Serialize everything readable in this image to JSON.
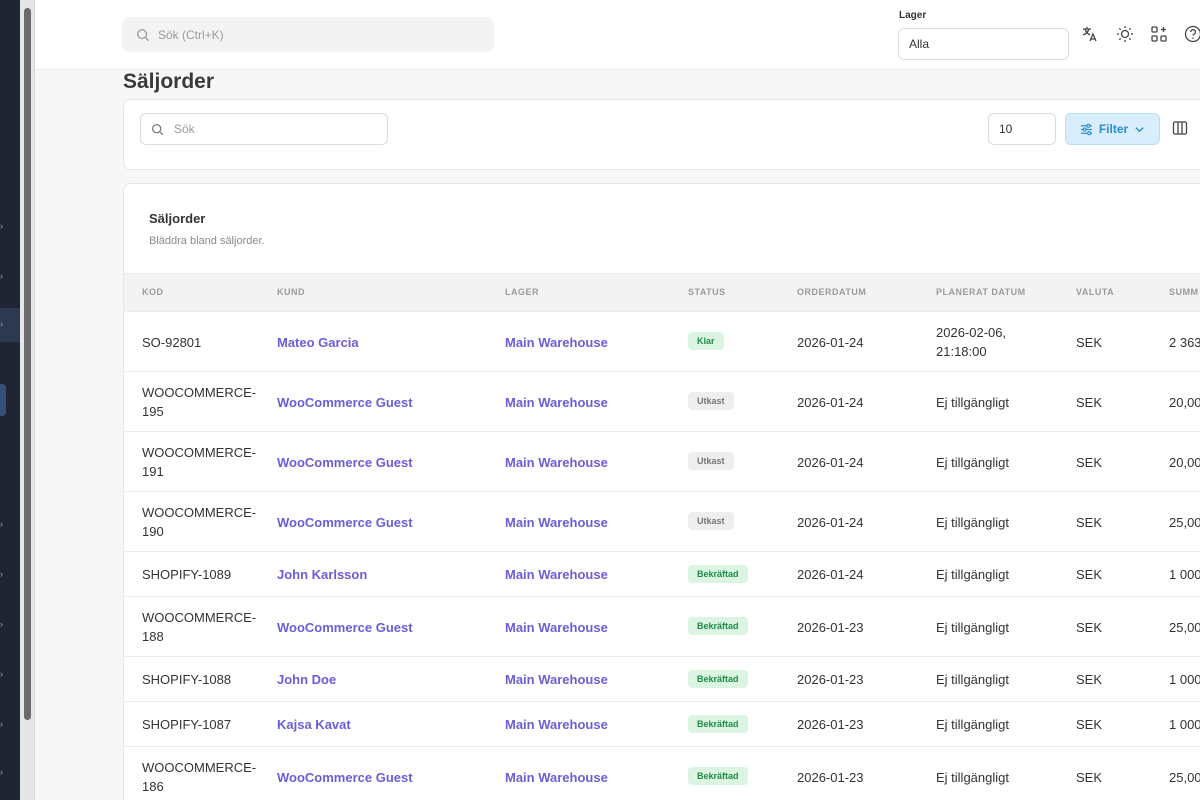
{
  "header": {
    "search_placeholder": "Sök (Ctrl+K)",
    "lager_label": "Lager",
    "lager_value": "Alla"
  },
  "page": {
    "title": "Säljorder"
  },
  "toolbar": {
    "search_placeholder": "Sök",
    "page_size": "10",
    "filter_label": "Filter"
  },
  "card": {
    "title": "Säljorder",
    "subtitle": "Bläddra bland säljorder."
  },
  "columns": [
    "KOD",
    "KUND",
    "LAGER",
    "STATUS",
    "ORDERDATUM",
    "PLANERAT DATUM",
    "VALUTA",
    "SUMM"
  ],
  "rows": [
    {
      "kod": [
        "SO-92801"
      ],
      "kund": "Mateo Garcia",
      "lager": "Main Warehouse",
      "status": "Klar",
      "status_type": "klar",
      "orderdatum": "2026-01-24",
      "planerat": [
        "2026-02-06,",
        "21:18:00"
      ],
      "valuta": "SEK",
      "summa": "2 363"
    },
    {
      "kod": [
        "WOOCOMMERCE-",
        "195"
      ],
      "kund": "WooCommerce Guest",
      "lager": "Main Warehouse",
      "status": "Utkast",
      "status_type": "utkast",
      "orderdatum": "2026-01-24",
      "planerat": [
        "Ej tillgängligt"
      ],
      "valuta": "SEK",
      "summa": "20,00"
    },
    {
      "kod": [
        "WOOCOMMERCE-",
        "191"
      ],
      "kund": "WooCommerce Guest",
      "lager": "Main Warehouse",
      "status": "Utkast",
      "status_type": "utkast",
      "orderdatum": "2026-01-24",
      "planerat": [
        "Ej tillgängligt"
      ],
      "valuta": "SEK",
      "summa": "20,00"
    },
    {
      "kod": [
        "WOOCOMMERCE-",
        "190"
      ],
      "kund": "WooCommerce Guest",
      "lager": "Main Warehouse",
      "status": "Utkast",
      "status_type": "utkast",
      "orderdatum": "2026-01-24",
      "planerat": [
        "Ej tillgängligt"
      ],
      "valuta": "SEK",
      "summa": "25,00"
    },
    {
      "kod": [
        "SHOPIFY-1089"
      ],
      "kund": "John Karlsson",
      "lager": "Main Warehouse",
      "status": "Bekräftad",
      "status_type": "bekraftad",
      "orderdatum": "2026-01-24",
      "planerat": [
        "Ej tillgängligt"
      ],
      "valuta": "SEK",
      "summa": "1 000"
    },
    {
      "kod": [
        "WOOCOMMERCE-",
        "188"
      ],
      "kund": "WooCommerce Guest",
      "lager": "Main Warehouse",
      "status": "Bekräftad",
      "status_type": "bekraftad",
      "orderdatum": "2026-01-23",
      "planerat": [
        "Ej tillgängligt"
      ],
      "valuta": "SEK",
      "summa": "25,00"
    },
    {
      "kod": [
        "SHOPIFY-1088"
      ],
      "kund": "John Doe",
      "lager": "Main Warehouse",
      "status": "Bekräftad",
      "status_type": "bekraftad",
      "orderdatum": "2026-01-23",
      "planerat": [
        "Ej tillgängligt"
      ],
      "valuta": "SEK",
      "summa": "1 000"
    },
    {
      "kod": [
        "SHOPIFY-1087"
      ],
      "kund": "Kajsa Kavat",
      "lager": "Main Warehouse",
      "status": "Bekräftad",
      "status_type": "bekraftad",
      "orderdatum": "2026-01-23",
      "planerat": [
        "Ej tillgängligt"
      ],
      "valuta": "SEK",
      "summa": "1 000"
    },
    {
      "kod": [
        "WOOCOMMERCE-",
        "186"
      ],
      "kund": "WooCommerce Guest",
      "lager": "Main Warehouse",
      "status": "Bekräftad",
      "status_type": "bekraftad",
      "orderdatum": "2026-01-23",
      "planerat": [
        "Ej tillgängligt"
      ],
      "valuta": "SEK",
      "summa": "25,00"
    }
  ],
  "icons": {
    "search": "search-icon",
    "translate": "translate-icon",
    "theme": "sun-icon",
    "apps": "apps-icon",
    "help": "help-icon",
    "filter": "sliders-icon",
    "chevron": "chevron-down-icon",
    "columns": "columns-icon"
  },
  "colors": {
    "link": "#6a5ed6",
    "filter_bg": "#d9eefc",
    "filter_text": "#2a8ccf",
    "success_bg": "#dcf5e3",
    "success_text": "#1e8b45",
    "sidebar": "#1f2533"
  }
}
